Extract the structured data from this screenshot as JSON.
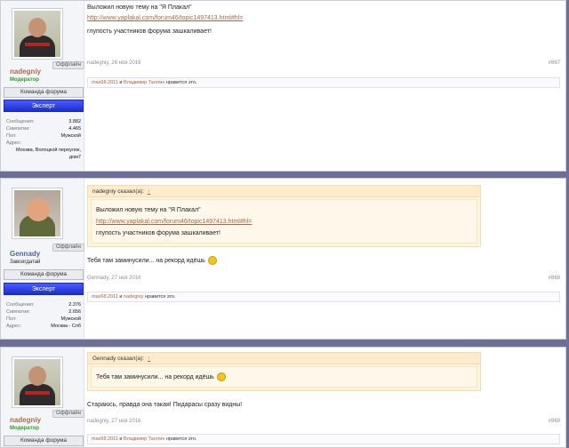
{
  "posts": [
    {
      "user": {
        "name": "nadegniy",
        "role": "Модератор",
        "status": "Оффлайн",
        "team": "Команда форума",
        "badge": "Эксперт",
        "stats": {
          "messages_label": "Сообщения:",
          "messages": "3.882",
          "likes_label": "Симпатии:",
          "likes": "4.465",
          "gender_label": "Пол:",
          "gender": "Мужской",
          "address_label": "Адрес:",
          "address": "Москва, Волоцкой переулок, дом7"
        }
      },
      "body": {
        "line1": "Выложил новую тему на \"Я Плакал\"",
        "link": "http://www.yaplakal.com/forum46/topic1497413.html#hl=",
        "line3": "глупость участников форума зашкаливает!"
      },
      "meta": {
        "author": "nadegniy",
        "date": "26 ноя 2016",
        "number": "#867"
      },
      "likes": {
        "u1": "max68.2011",
        "and": "и",
        "u2": "Владимир Таллин",
        "suffix": "нравится это."
      }
    },
    {
      "user": {
        "name": "Gennady",
        "role": "Завсегдатай",
        "status": "Оффлайн",
        "team": "Команда форума",
        "badge": "Эксперт",
        "stats": {
          "messages_label": "Сообщения:",
          "messages": "2.376",
          "likes_label": "Симпатии:",
          "likes": "2.656",
          "gender_label": "Пол:",
          "gender": "Мужской",
          "address_label": "Адрес:",
          "address": "Москва - Спб"
        }
      },
      "quote": {
        "author": "nadegniy сказал(а):",
        "up": "↑",
        "line1": "Выложил новую тему на \"Я Плакал\"",
        "link": "http://www.yaplakal.com/forum46/topic1497413.html#hl=",
        "line3": "глупость участников форума зашкаливает!"
      },
      "body": {
        "line1": "Тебя там заминусили... на рекорд идёшь"
      },
      "meta": {
        "author": "Gennady",
        "date": "27 ноя 2016",
        "number": "#868"
      },
      "likes": {
        "u1": "max68.2011",
        "and": "и",
        "u2": "nadegniy",
        "suffix": "нравится это."
      }
    },
    {
      "user": {
        "name": "nadegniy",
        "role": "Модератор",
        "status": "Оффлайн",
        "team": "Команда форума"
      },
      "quote": {
        "author": "Gennady сказал(а):",
        "up": "↑",
        "line1": "Тебя там заминусили... на рекорд идёшь"
      },
      "body": {
        "line1": "Стараюсь, правда она такая! Пидарасы сразу видны!"
      },
      "meta": {
        "author": "nadegniy",
        "date": "27 ноя 2016",
        "number": "#869"
      },
      "likes": {
        "u1": "max68.2011",
        "and": "и",
        "u2": "Владимир Таллин",
        "suffix": "нравится это."
      }
    }
  ]
}
